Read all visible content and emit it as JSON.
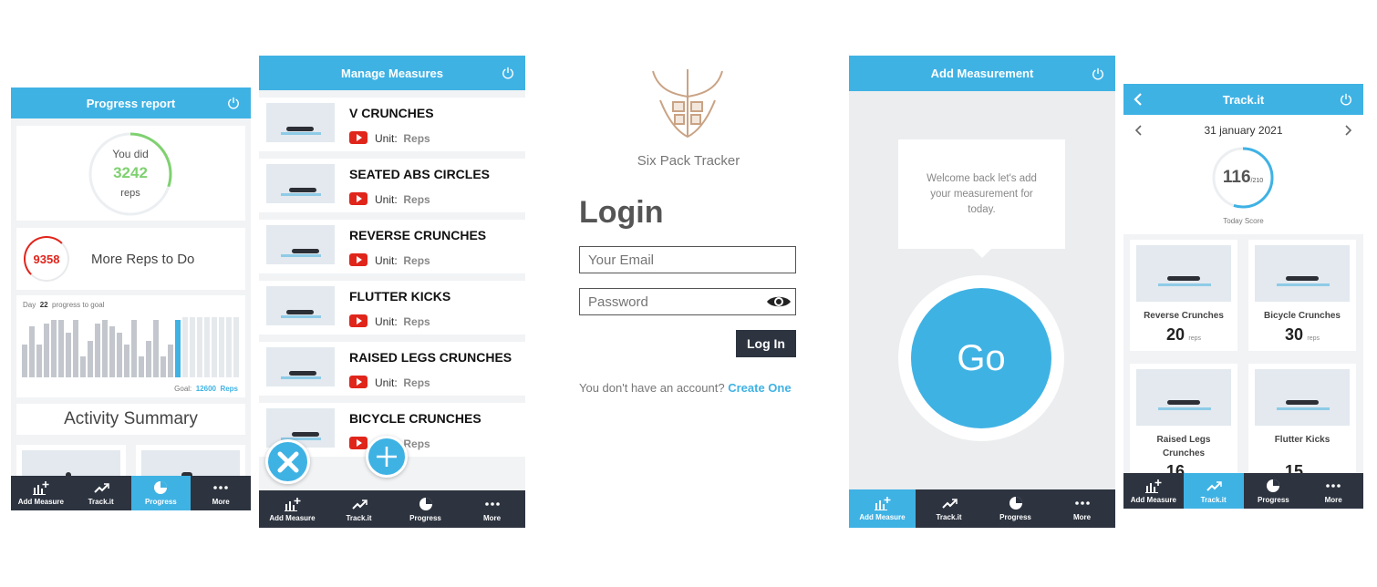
{
  "s1": {
    "title": "Progress report",
    "you_did": "You did",
    "total_reps": "3242",
    "reps_label": "reps",
    "progress_fraction": 0.3,
    "remaining": "9358",
    "more_reps": "More Reps to Do",
    "day_label": "Day",
    "day_num": "22",
    "progress_to_goal": "progress to goal",
    "bars": [
      0.55,
      0.85,
      0.55,
      0.9,
      0.95,
      0.95,
      0.75,
      0.95,
      0.35,
      0.6,
      0.9,
      0.95,
      0.85,
      0.75,
      0.55,
      0.95,
      0.35,
      0.6,
      0.95,
      0.35,
      0.55,
      0.95
    ],
    "goal_label": "Goal:",
    "goal_value": "12600",
    "goal_unit": "Reps",
    "activity_summary": "Activity Summary",
    "nav": [
      "Add Measure",
      "Track.it",
      "Progress",
      "More"
    ]
  },
  "s2": {
    "title": "Manage Measures",
    "unit_label": "Unit:",
    "items": [
      {
        "name": "V CRUNCHES",
        "unit": "Reps"
      },
      {
        "name": "SEATED ABS CIRCLES",
        "unit": "Reps"
      },
      {
        "name": "REVERSE CRUNCHES",
        "unit": "Reps"
      },
      {
        "name": "FLUTTER KICKS",
        "unit": "Reps"
      },
      {
        "name": "RAISED LEGS CRUNCHES",
        "unit": "Reps"
      },
      {
        "name": "BICYCLE CRUNCHES",
        "unit": "Reps"
      }
    ],
    "nav": [
      "Add Measure",
      "Track.it",
      "Progress",
      "More"
    ]
  },
  "s3": {
    "app_name": "Six Pack Tracker",
    "login_title": "Login",
    "email_placeholder": "Your Email",
    "password_placeholder": "Password",
    "login_button": "Log In",
    "no_account": "You don't have an account?",
    "create_one": "Create One"
  },
  "s4": {
    "title": "Add Measurement",
    "welcome": "Welcome back let's add your measurement for today.",
    "go": "Go",
    "nav": [
      "Add Measure",
      "Track.it",
      "Progress",
      "More"
    ]
  },
  "s5": {
    "title": "Track.it",
    "date": "31 january 2021",
    "score": "116",
    "score_max": "/210",
    "score_fraction": 0.55,
    "today_score": "Today Score",
    "reps_unit": "reps",
    "cards": [
      {
        "name": "Reverse Crunches",
        "value": "20"
      },
      {
        "name": "Bicycle Crunches",
        "value": "30"
      },
      {
        "name": "Raised Legs Crunches",
        "value": "16"
      },
      {
        "name": "Flutter Kicks",
        "value": "15"
      }
    ],
    "nav": [
      "Add Measure",
      "Track.it",
      "Progress",
      "More"
    ]
  },
  "colors": {
    "accent": "#3fb2e4",
    "dark": "#2d3440",
    "green": "#7fd170",
    "red": "#e0251b"
  }
}
